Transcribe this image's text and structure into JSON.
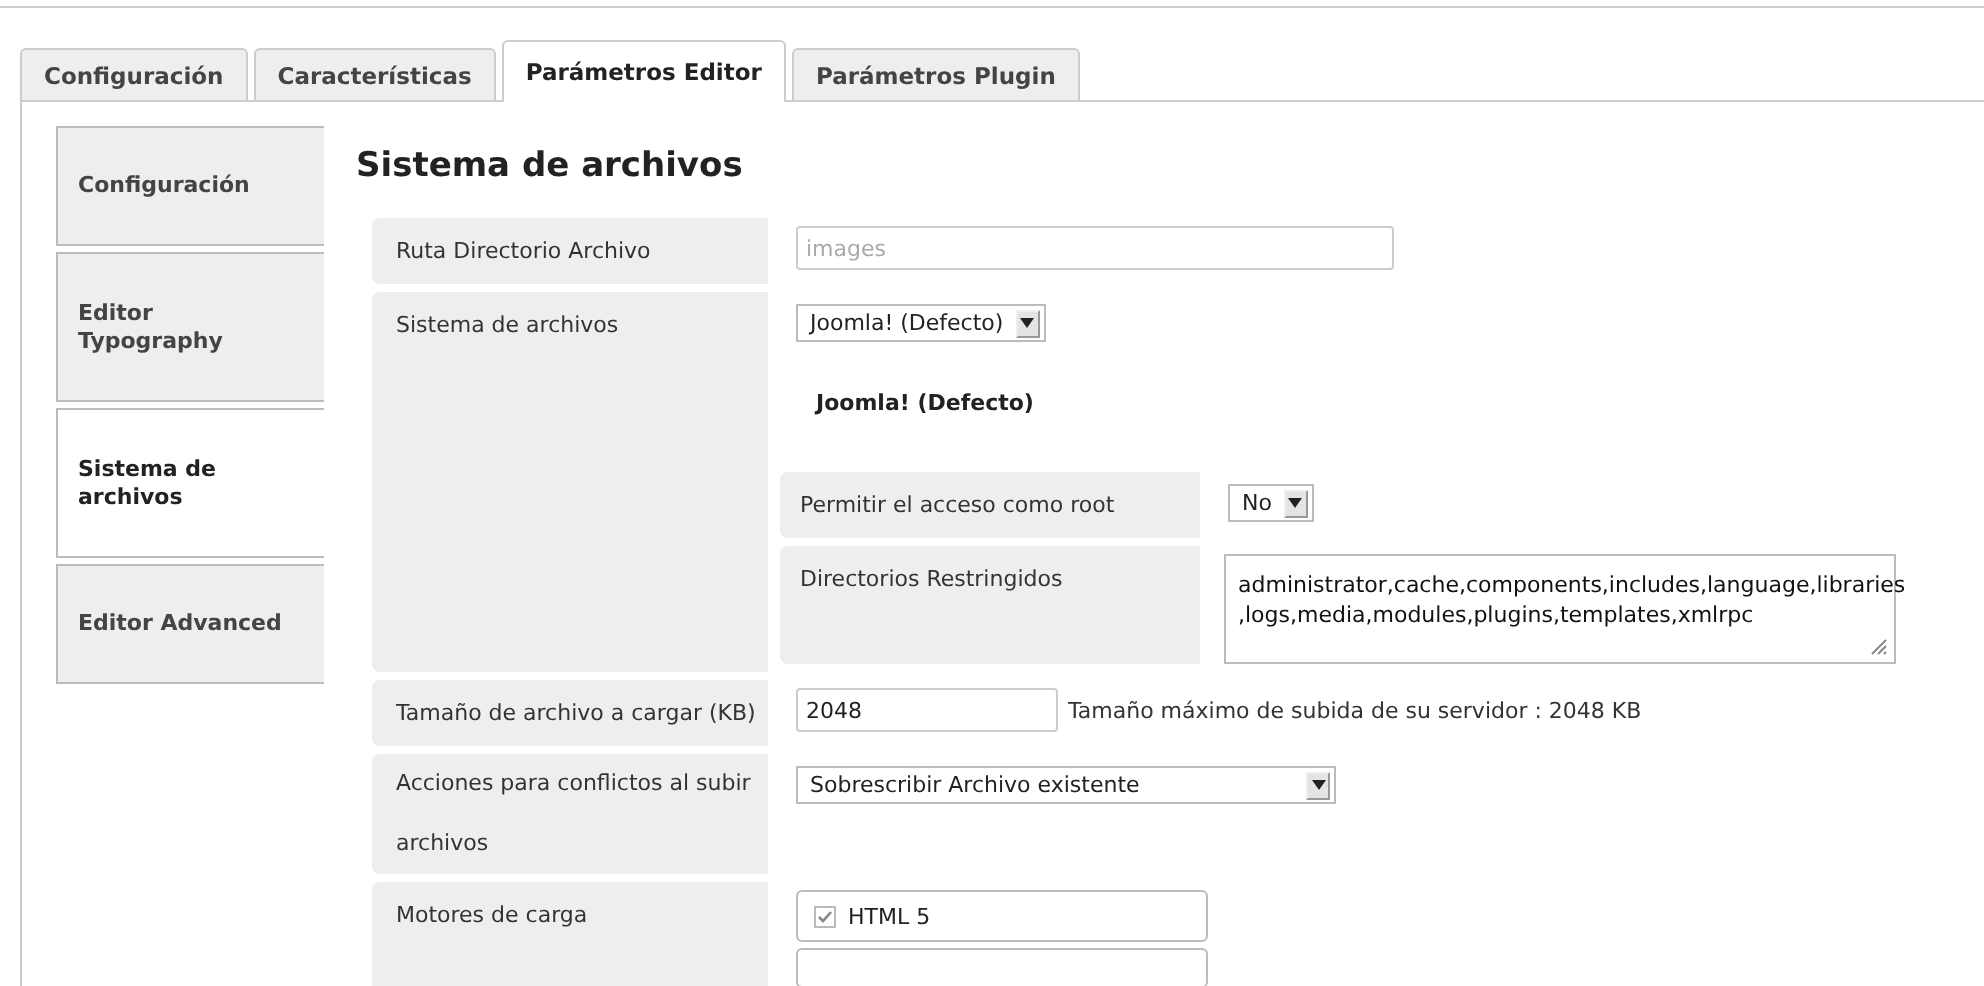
{
  "tabs": [
    {
      "label": "Configuración",
      "selected": false
    },
    {
      "label": "Características",
      "selected": false
    },
    {
      "label": "Parámetros Editor",
      "selected": true
    },
    {
      "label": "Parámetros Plugin",
      "selected": false
    }
  ],
  "sidebar": {
    "items": [
      {
        "label": "Configuración",
        "selected": false
      },
      {
        "label": "Editor Typography",
        "selected": false
      },
      {
        "label": "Sistema de archivos",
        "selected": true
      },
      {
        "label": "Editor Advanced",
        "selected": false
      }
    ]
  },
  "heading": "Sistema de archivos",
  "fields": [
    {
      "kind": "text",
      "label": "Ruta Directorio Archivo",
      "placeholder": "images"
    },
    {
      "kind": "filesystem",
      "label": "Sistema de archivos",
      "value": "Joomla! (Defecto)",
      "subtitle": "Joomla! (Defecto)",
      "subfields": [
        {
          "kind": "select",
          "label": "Permitir el acceso como root",
          "value": "No"
        },
        {
          "kind": "textarea",
          "label": "Directorios Restringidos",
          "lines": [
            "administrator,cache,components,includes,language,libraries",
            ",logs,media,modules,plugins,templates,xmlrpc"
          ]
        }
      ]
    },
    {
      "kind": "number",
      "label": "Tamaño de archivo a cargar (KB)",
      "value": "2048",
      "note": "Tamaño máximo de subida de su servidor : 2048 KB"
    },
    {
      "kind": "select",
      "label": "Acciones para conflictos al subir archivos",
      "value": "Sobrescribir Archivo existente"
    },
    {
      "kind": "checklist",
      "label": "Motores de carga",
      "items": [
        {
          "label": "HTML 5",
          "checked": true
        }
      ]
    }
  ]
}
